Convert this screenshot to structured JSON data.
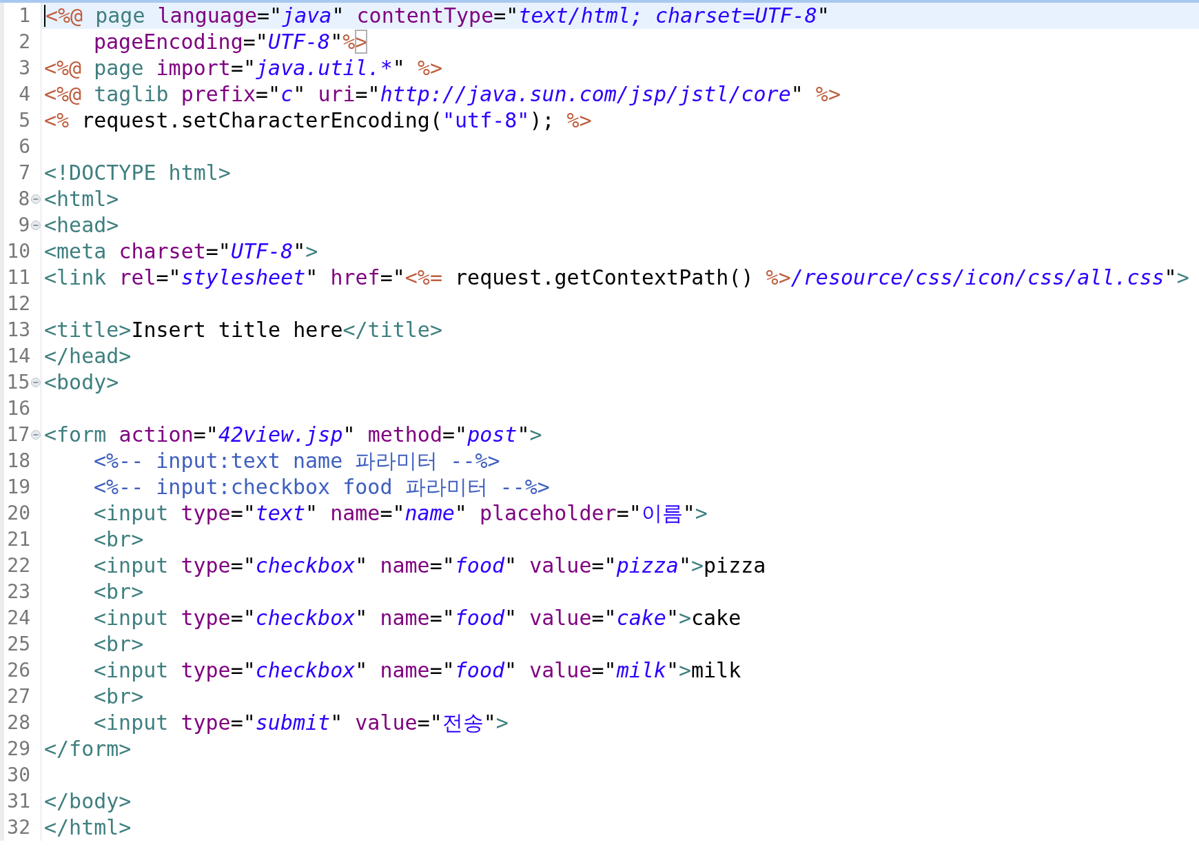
{
  "editor": {
    "lines": [
      {
        "number": "1",
        "current": true,
        "fold": false,
        "indent": false,
        "cursor": true,
        "tokens": [
          {
            "kind": "jsp",
            "text": "<%@"
          },
          {
            "kind": "directive",
            "text": " page "
          },
          {
            "kind": "attr",
            "text": "language"
          },
          {
            "kind": "plain",
            "text": "=\""
          },
          {
            "kind": "value",
            "text": "java"
          },
          {
            "kind": "plain",
            "text": "\" "
          },
          {
            "kind": "attr",
            "text": "contentType"
          },
          {
            "kind": "plain",
            "text": "=\""
          },
          {
            "kind": "value",
            "text": "text/html; charset=UTF-8"
          },
          {
            "kind": "plain",
            "text": "\""
          }
        ]
      },
      {
        "number": "2",
        "current": false,
        "fold": false,
        "indent": true,
        "cursor": false,
        "tokens": [
          {
            "kind": "attr",
            "text": "pageEncoding"
          },
          {
            "kind": "plain",
            "text": "=\""
          },
          {
            "kind": "value",
            "text": "UTF-8"
          },
          {
            "kind": "plain",
            "text": "\""
          },
          {
            "kind": "jsp",
            "text": "%"
          },
          {
            "kind": "jsp",
            "text": ">",
            "matched": true
          }
        ]
      },
      {
        "number": "3",
        "current": false,
        "fold": false,
        "indent": false,
        "cursor": false,
        "tokens": [
          {
            "kind": "jsp",
            "text": "<%@"
          },
          {
            "kind": "directive",
            "text": " page "
          },
          {
            "kind": "attr",
            "text": "import"
          },
          {
            "kind": "plain",
            "text": "=\""
          },
          {
            "kind": "value",
            "text": "java.util.*"
          },
          {
            "kind": "plain",
            "text": "\" "
          },
          {
            "kind": "jsp",
            "text": "%>"
          }
        ]
      },
      {
        "number": "4",
        "current": false,
        "fold": false,
        "indent": false,
        "cursor": false,
        "tokens": [
          {
            "kind": "jsp",
            "text": "<%@"
          },
          {
            "kind": "directive",
            "text": " taglib "
          },
          {
            "kind": "attr",
            "text": "prefix"
          },
          {
            "kind": "plain",
            "text": "=\""
          },
          {
            "kind": "value",
            "text": "c"
          },
          {
            "kind": "plain",
            "text": "\" "
          },
          {
            "kind": "attr",
            "text": "uri"
          },
          {
            "kind": "plain",
            "text": "=\""
          },
          {
            "kind": "value",
            "text": "http://java.sun.com/jsp/jstl/core"
          },
          {
            "kind": "plain",
            "text": "\" "
          },
          {
            "kind": "jsp",
            "text": "%>"
          }
        ]
      },
      {
        "number": "5",
        "current": false,
        "fold": false,
        "indent": false,
        "cursor": false,
        "tokens": [
          {
            "kind": "jsp",
            "text": "<%"
          },
          {
            "kind": "plain",
            "text": " request.setCharacterEncoding("
          },
          {
            "kind": "string",
            "text": "\"utf-8\""
          },
          {
            "kind": "plain",
            "text": "); "
          },
          {
            "kind": "jsp",
            "text": "%>"
          }
        ]
      },
      {
        "number": "6",
        "current": false,
        "fold": false,
        "cursor": false
      },
      {
        "number": "7",
        "current": false,
        "fold": false,
        "indent": false,
        "cursor": false,
        "tokens": [
          {
            "kind": "tag",
            "text": "<!DOCTYPE html>"
          }
        ]
      },
      {
        "number": "8",
        "current": false,
        "fold": true,
        "indent": false,
        "cursor": false,
        "tokens": [
          {
            "kind": "tag",
            "text": "<html>"
          }
        ]
      },
      {
        "number": "9",
        "current": false,
        "fold": true,
        "indent": false,
        "cursor": false,
        "tokens": [
          {
            "kind": "tag",
            "text": "<head>"
          }
        ]
      },
      {
        "number": "10",
        "current": false,
        "fold": false,
        "indent": false,
        "cursor": false,
        "tokens": [
          {
            "kind": "tag",
            "text": "<meta "
          },
          {
            "kind": "attr",
            "text": "charset"
          },
          {
            "kind": "plain",
            "text": "=\""
          },
          {
            "kind": "value",
            "text": "UTF-8"
          },
          {
            "kind": "plain",
            "text": "\""
          },
          {
            "kind": "tag",
            "text": ">"
          }
        ]
      },
      {
        "number": "11",
        "current": false,
        "fold": false,
        "indent": false,
        "cursor": false,
        "tokens": [
          {
            "kind": "tag",
            "text": "<link "
          },
          {
            "kind": "attr",
            "text": "rel"
          },
          {
            "kind": "plain",
            "text": "=\""
          },
          {
            "kind": "value",
            "text": "stylesheet"
          },
          {
            "kind": "plain",
            "text": "\" "
          },
          {
            "kind": "attr",
            "text": "href"
          },
          {
            "kind": "plain",
            "text": "=\""
          },
          {
            "kind": "jsp",
            "text": "<%="
          },
          {
            "kind": "plain",
            "text": " request.getContextPath() "
          },
          {
            "kind": "jsp",
            "text": "%>"
          },
          {
            "kind": "value",
            "text": "/resource/css/icon/css/all.css"
          },
          {
            "kind": "plain",
            "text": "\""
          },
          {
            "kind": "tag",
            "text": ">"
          }
        ]
      },
      {
        "number": "12",
        "current": false,
        "fold": false,
        "cursor": false
      },
      {
        "number": "13",
        "current": false,
        "fold": false,
        "indent": false,
        "cursor": false,
        "tokens": [
          {
            "kind": "tag",
            "text": "<title>"
          },
          {
            "kind": "plain",
            "text": "Insert title here"
          },
          {
            "kind": "tag",
            "text": "</title>"
          }
        ]
      },
      {
        "number": "14",
        "current": false,
        "fold": false,
        "indent": false,
        "cursor": false,
        "tokens": [
          {
            "kind": "tag",
            "text": "</head>"
          }
        ]
      },
      {
        "number": "15",
        "current": false,
        "fold": true,
        "indent": false,
        "cursor": false,
        "tokens": [
          {
            "kind": "tag",
            "text": "<body>"
          }
        ]
      },
      {
        "number": "16",
        "current": false,
        "fold": false,
        "cursor": false
      },
      {
        "number": "17",
        "current": false,
        "fold": true,
        "indent": false,
        "cursor": false,
        "tokens": [
          {
            "kind": "tag",
            "text": "<form "
          },
          {
            "kind": "attr",
            "text": "action"
          },
          {
            "kind": "plain",
            "text": "=\""
          },
          {
            "kind": "value",
            "text": "42view.jsp"
          },
          {
            "kind": "plain",
            "text": "\" "
          },
          {
            "kind": "attr",
            "text": "method"
          },
          {
            "kind": "plain",
            "text": "=\""
          },
          {
            "kind": "value",
            "text": "post"
          },
          {
            "kind": "plain",
            "text": "\""
          },
          {
            "kind": "tag",
            "text": ">"
          }
        ]
      },
      {
        "number": "18",
        "current": false,
        "fold": false,
        "indent": true,
        "cursor": false,
        "tokens": [
          {
            "kind": "comment",
            "text": "<%-- input:text name 파라미터 --%>"
          }
        ]
      },
      {
        "number": "19",
        "current": false,
        "fold": false,
        "indent": true,
        "cursor": false,
        "tokens": [
          {
            "kind": "comment",
            "text": "<%-- input:checkbox food 파라미터 --%>"
          }
        ]
      },
      {
        "number": "20",
        "current": false,
        "fold": false,
        "indent": true,
        "cursor": false,
        "tokens": [
          {
            "kind": "tag",
            "text": "<input "
          },
          {
            "kind": "attr",
            "text": "type"
          },
          {
            "kind": "plain",
            "text": "=\""
          },
          {
            "kind": "value",
            "text": "text"
          },
          {
            "kind": "plain",
            "text": "\" "
          },
          {
            "kind": "attr",
            "text": "name"
          },
          {
            "kind": "plain",
            "text": "=\""
          },
          {
            "kind": "value",
            "text": "name"
          },
          {
            "kind": "plain",
            "text": "\" "
          },
          {
            "kind": "attr",
            "text": "placeholder"
          },
          {
            "kind": "plain",
            "text": "=\""
          },
          {
            "kind": "string",
            "text": "이름"
          },
          {
            "kind": "plain",
            "text": "\""
          },
          {
            "kind": "tag",
            "text": ">"
          }
        ]
      },
      {
        "number": "21",
        "current": false,
        "fold": false,
        "indent": true,
        "cursor": false,
        "tokens": [
          {
            "kind": "tag",
            "text": "<br>"
          }
        ]
      },
      {
        "number": "22",
        "current": false,
        "fold": false,
        "indent": true,
        "cursor": false,
        "tokens": [
          {
            "kind": "tag",
            "text": "<input "
          },
          {
            "kind": "attr",
            "text": "type"
          },
          {
            "kind": "plain",
            "text": "=\""
          },
          {
            "kind": "value",
            "text": "checkbox"
          },
          {
            "kind": "plain",
            "text": "\" "
          },
          {
            "kind": "attr",
            "text": "name"
          },
          {
            "kind": "plain",
            "text": "=\""
          },
          {
            "kind": "value",
            "text": "food"
          },
          {
            "kind": "plain",
            "text": "\" "
          },
          {
            "kind": "attr",
            "text": "value"
          },
          {
            "kind": "plain",
            "text": "=\""
          },
          {
            "kind": "value",
            "text": "pizza"
          },
          {
            "kind": "plain",
            "text": "\""
          },
          {
            "kind": "tag",
            "text": ">"
          },
          {
            "kind": "plain",
            "text": "pizza"
          }
        ]
      },
      {
        "number": "23",
        "current": false,
        "fold": false,
        "indent": true,
        "cursor": false,
        "tokens": [
          {
            "kind": "tag",
            "text": "<br>"
          }
        ]
      },
      {
        "number": "24",
        "current": false,
        "fold": false,
        "indent": true,
        "cursor": false,
        "tokens": [
          {
            "kind": "tag",
            "text": "<input "
          },
          {
            "kind": "attr",
            "text": "type"
          },
          {
            "kind": "plain",
            "text": "=\""
          },
          {
            "kind": "value",
            "text": "checkbox"
          },
          {
            "kind": "plain",
            "text": "\" "
          },
          {
            "kind": "attr",
            "text": "name"
          },
          {
            "kind": "plain",
            "text": "=\""
          },
          {
            "kind": "value",
            "text": "food"
          },
          {
            "kind": "plain",
            "text": "\" "
          },
          {
            "kind": "attr",
            "text": "value"
          },
          {
            "kind": "plain",
            "text": "=\""
          },
          {
            "kind": "value",
            "text": "cake"
          },
          {
            "kind": "plain",
            "text": "\""
          },
          {
            "kind": "tag",
            "text": ">"
          },
          {
            "kind": "plain",
            "text": "cake"
          }
        ]
      },
      {
        "number": "25",
        "current": false,
        "fold": false,
        "indent": true,
        "cursor": false,
        "tokens": [
          {
            "kind": "tag",
            "text": "<br>"
          }
        ]
      },
      {
        "number": "26",
        "current": false,
        "fold": false,
        "indent": true,
        "cursor": false,
        "tokens": [
          {
            "kind": "tag",
            "text": "<input "
          },
          {
            "kind": "attr",
            "text": "type"
          },
          {
            "kind": "plain",
            "text": "=\""
          },
          {
            "kind": "value",
            "text": "checkbox"
          },
          {
            "kind": "plain",
            "text": "\" "
          },
          {
            "kind": "attr",
            "text": "name"
          },
          {
            "kind": "plain",
            "text": "=\""
          },
          {
            "kind": "value",
            "text": "food"
          },
          {
            "kind": "plain",
            "text": "\" "
          },
          {
            "kind": "attr",
            "text": "value"
          },
          {
            "kind": "plain",
            "text": "=\""
          },
          {
            "kind": "value",
            "text": "milk"
          },
          {
            "kind": "plain",
            "text": "\""
          },
          {
            "kind": "tag",
            "text": ">"
          },
          {
            "kind": "plain",
            "text": "milk"
          }
        ]
      },
      {
        "number": "27",
        "current": false,
        "fold": false,
        "indent": true,
        "cursor": false,
        "tokens": [
          {
            "kind": "tag",
            "text": "<br>"
          }
        ]
      },
      {
        "number": "28",
        "current": false,
        "fold": false,
        "indent": true,
        "cursor": false,
        "tokens": [
          {
            "kind": "tag",
            "text": "<input "
          },
          {
            "kind": "attr",
            "text": "type"
          },
          {
            "kind": "plain",
            "text": "=\""
          },
          {
            "kind": "value",
            "text": "submit"
          },
          {
            "kind": "plain",
            "text": "\" "
          },
          {
            "kind": "attr",
            "text": "value"
          },
          {
            "kind": "plain",
            "text": "=\""
          },
          {
            "kind": "string",
            "text": "전송"
          },
          {
            "kind": "plain",
            "text": "\""
          },
          {
            "kind": "tag",
            "text": ">"
          }
        ]
      },
      {
        "number": "29",
        "current": false,
        "fold": false,
        "indent": false,
        "cursor": false,
        "tokens": [
          {
            "kind": "tag",
            "text": "</form>"
          }
        ]
      },
      {
        "number": "30",
        "current": false,
        "fold": false,
        "cursor": false
      },
      {
        "number": "31",
        "current": false,
        "fold": false,
        "indent": false,
        "cursor": false,
        "tokens": [
          {
            "kind": "tag",
            "text": "</body>"
          }
        ]
      },
      {
        "number": "32",
        "current": false,
        "fold": false,
        "indent": false,
        "cursor": false,
        "tokens": [
          {
            "kind": "tag",
            "text": "</html>"
          }
        ]
      }
    ]
  }
}
